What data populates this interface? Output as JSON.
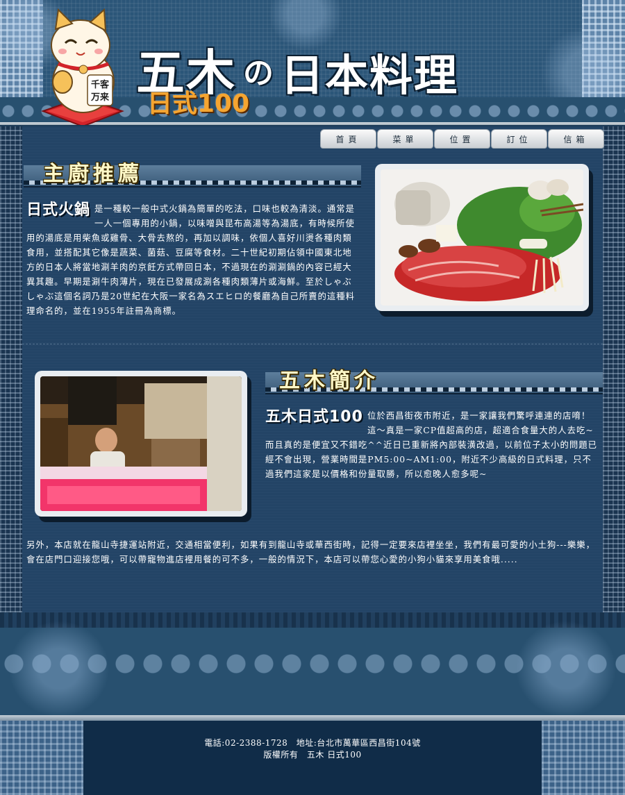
{
  "header": {
    "title_main": "五木",
    "title_no": "の",
    "title_rest": "日本料理",
    "subtitle": "日式100",
    "mascot_name": "lucky-cat",
    "mascot_text": "千客万来"
  },
  "nav": {
    "items": [
      "首頁",
      "菜單",
      "位置",
      "訂位",
      "信箱"
    ]
  },
  "chef_recommend": {
    "title": "主廚推薦",
    "lead": "日式火鍋",
    "text": "是一種較一般中式火鍋為簡單的吃法，口味也較為清淡。通常是一人一個專用的小鍋，以味噌與昆布高湯等為湯底，有時候所使用的湯底是用柴魚或雞骨、大骨去熬的，再加以調味，依個人喜好川燙各種肉類食用，並搭配其它像是蔬菜、菌菇、豆腐等食材。二十世紀初期佔領中國東北地方的日本人將當地涮羊肉的京飪方式帶回日本，不過現在的涮涮鍋的內容已經大異其趣。早期是涮牛肉薄片，現在已發展成涮各種肉類薄片或海鮮。至於しゃぶしゃぶ這個名詞乃是20世紀在大阪一家名為スエヒロ的餐廳為自己所賣的這種料理命名的，並在1955年註冊為商標。"
  },
  "about": {
    "title": "五木簡介",
    "lead": "五木日式100",
    "text": "位於西昌街夜市附近，是一家讓我們驚呼連連的店唷！這～真是一家CP值超高的店，超適合食量大的人去吃~而且真的是便宜又不錯吃^^近日已重新將內部裝潢改過，以前位子太小的問題已經不會出現，營業時間是PM5:00~AM1:00，附近不少高級的日式料理，只不過我們這家是以價格和份量取勝，所以愈晚人愈多呢~",
    "extra": "另外，本店就在龍山寺捷運站附近，交通相當便利，如果有到龍山寺或華西街時，記得一定要來店裡坐坐，我們有最可愛的小土狗---樂樂，會在店門口迎接您哦，可以帶寵物進店裡用餐的可不多，一般的情況下，本店可以帶您心愛的小狗小貓來享用美食哦....."
  },
  "footer": {
    "line1": "電話:02-2388-1728　地址:台北市萬華區西昌街104號",
    "line2": "版權所有　五木 日式100"
  },
  "colors": {
    "background": "#1d3b58",
    "header": "#2b5578",
    "accent_orange": "#f5a531",
    "section_title": "#fff8c8"
  }
}
